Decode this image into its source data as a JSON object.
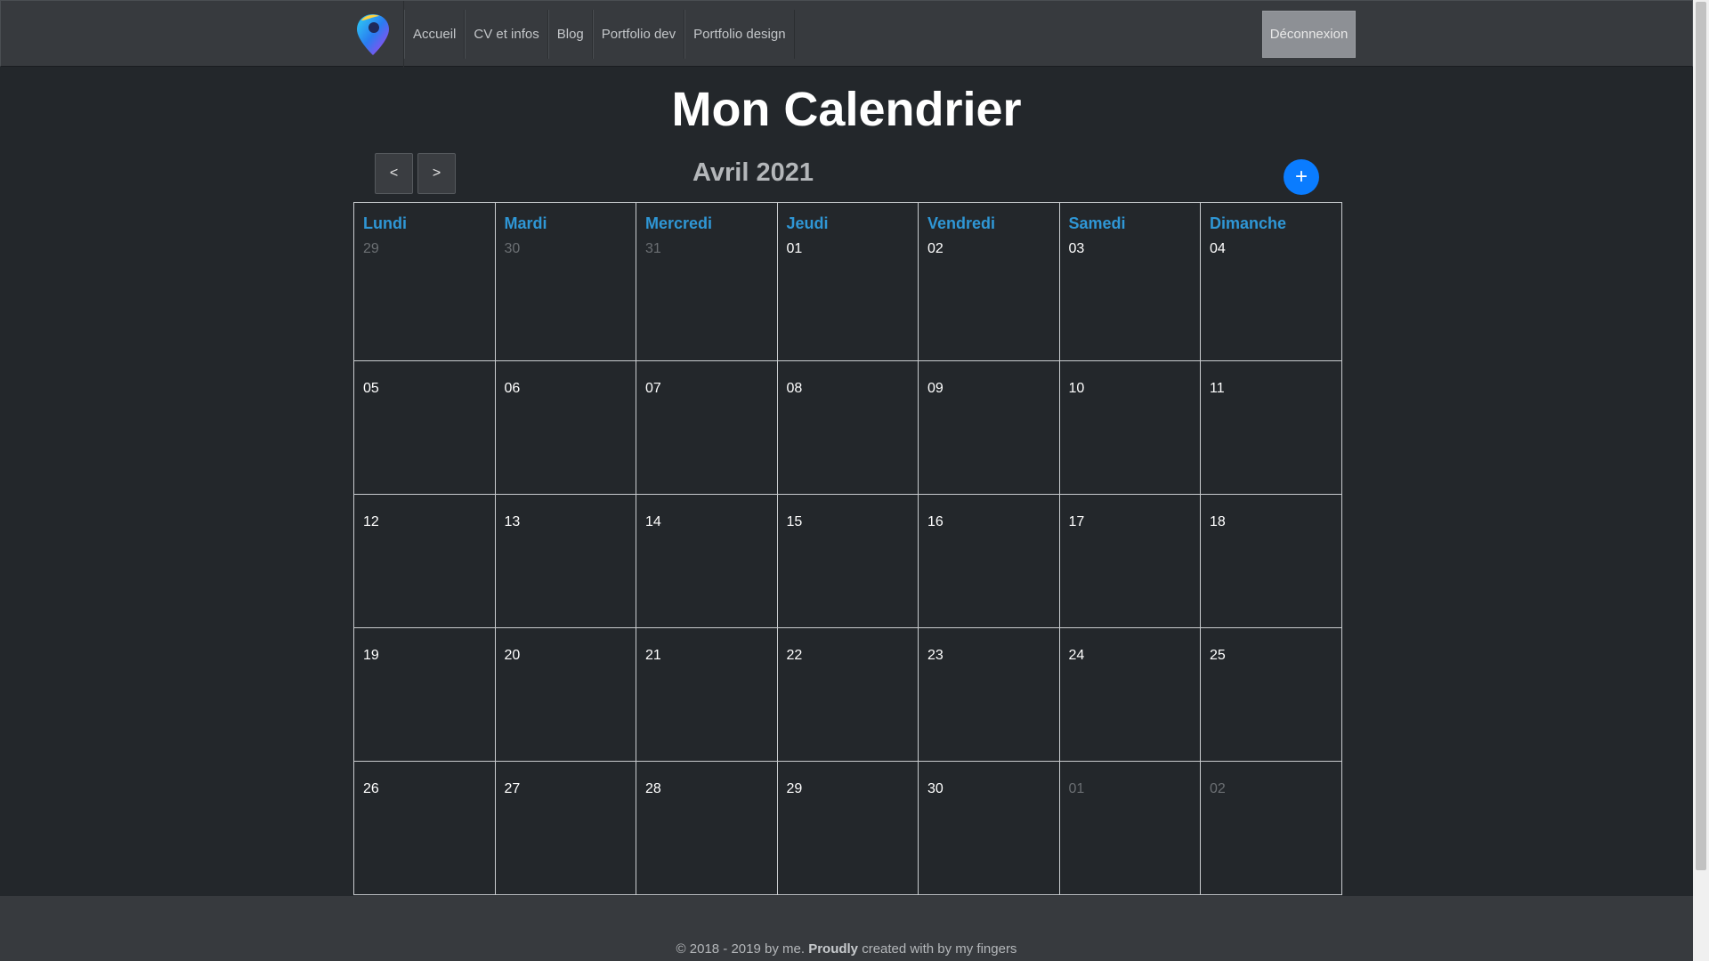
{
  "nav": {
    "links": [
      "Accueil",
      "CV et infos",
      "Blog",
      "Portfolio dev",
      "Portfolio design"
    ],
    "logout_label": "Déconnexion"
  },
  "page": {
    "title": "Mon Calendrier",
    "prev_label": "<",
    "next_label": ">",
    "month_label": "Avril 2021",
    "add_label": "+"
  },
  "calendar": {
    "weekdays": [
      "Lundi",
      "Mardi",
      "Mercredi",
      "Jeudi",
      "Vendredi",
      "Samedi",
      "Dimanche"
    ],
    "weeks": [
      [
        {
          "d": "29",
          "other": true
        },
        {
          "d": "30",
          "other": true
        },
        {
          "d": "31",
          "other": true
        },
        {
          "d": "01"
        },
        {
          "d": "02"
        },
        {
          "d": "03"
        },
        {
          "d": "04"
        }
      ],
      [
        {
          "d": "05"
        },
        {
          "d": "06"
        },
        {
          "d": "07"
        },
        {
          "d": "08"
        },
        {
          "d": "09"
        },
        {
          "d": "10"
        },
        {
          "d": "11"
        }
      ],
      [
        {
          "d": "12"
        },
        {
          "d": "13"
        },
        {
          "d": "14"
        },
        {
          "d": "15"
        },
        {
          "d": "16"
        },
        {
          "d": "17"
        },
        {
          "d": "18"
        }
      ],
      [
        {
          "d": "19"
        },
        {
          "d": "20"
        },
        {
          "d": "21"
        },
        {
          "d": "22"
        },
        {
          "d": "23"
        },
        {
          "d": "24"
        },
        {
          "d": "25"
        }
      ],
      [
        {
          "d": "26"
        },
        {
          "d": "27"
        },
        {
          "d": "28"
        },
        {
          "d": "29"
        },
        {
          "d": "30"
        },
        {
          "d": "01",
          "other": true
        },
        {
          "d": "02",
          "other": true
        }
      ]
    ]
  },
  "footer": {
    "prefix": "© 2018 - 2019 by me. ",
    "bold": "Proudly",
    "suffix": " created with by my fingers"
  },
  "colors": {
    "background": "#23272b",
    "navbar": "#373a3e",
    "weekday": "#2f97d6",
    "add_button": "#0a7cff"
  },
  "icons": {
    "logo": "location-pin-logo"
  }
}
